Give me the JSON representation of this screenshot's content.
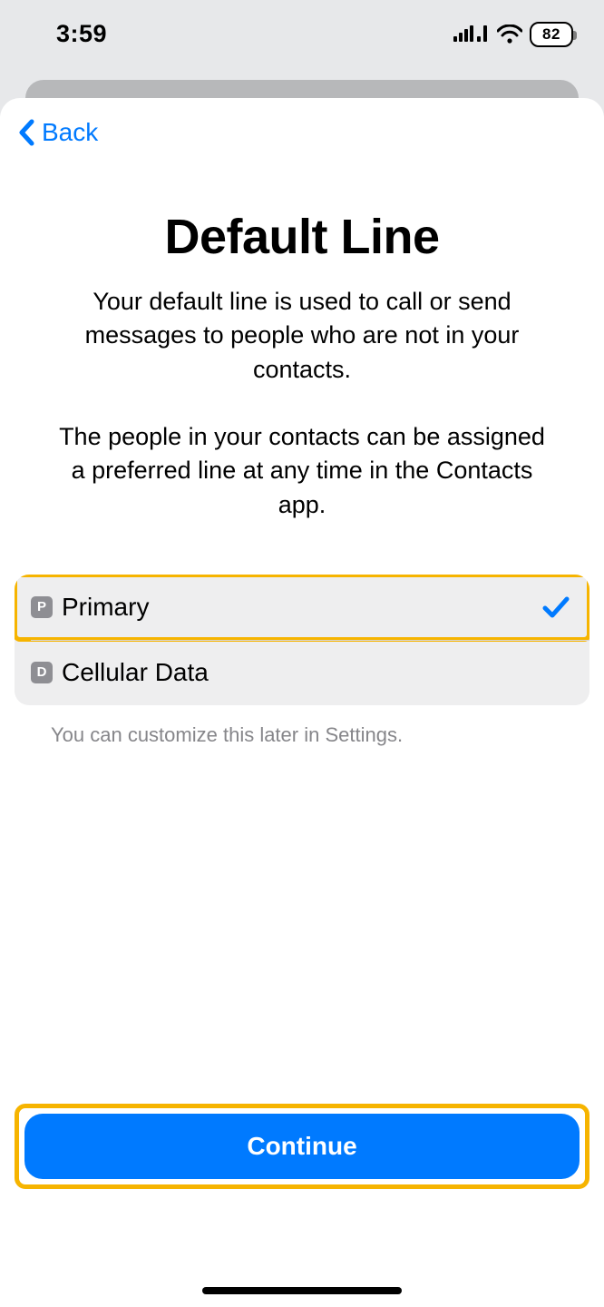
{
  "status": {
    "time": "3:59",
    "battery": "82"
  },
  "nav": {
    "back": "Back"
  },
  "page": {
    "title": "Default Line",
    "description": "Your default line is used to call or send messages to people who are not in your contacts.\n\nThe people in your contacts can be assigned a preferred line at any time in the Contacts app.",
    "footnote": "You can customize this later in Settings."
  },
  "options": [
    {
      "badge": "P",
      "label": "Primary",
      "selected": true
    },
    {
      "badge": "D",
      "label": "Cellular Data",
      "selected": false
    }
  ],
  "actions": {
    "continue": "Continue"
  }
}
